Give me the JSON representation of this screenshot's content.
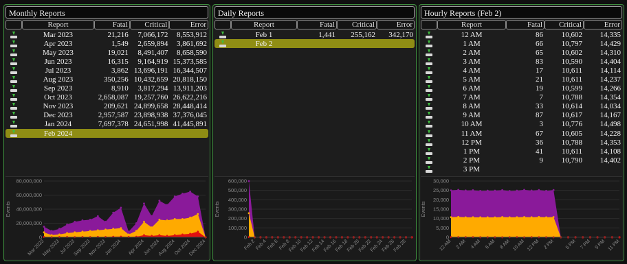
{
  "monthly": {
    "title": "Monthly Reports",
    "columns": {
      "report": "Report",
      "fatal": "Fatal",
      "critical": "Critical",
      "error": "Error"
    },
    "rows": [
      {
        "report": "Mar 2023",
        "fatal": "21,216",
        "critical": "7,066,172",
        "error": "8,553,912"
      },
      {
        "report": "Apr 2023",
        "fatal": "1,549",
        "critical": "2,659,894",
        "error": "3,861,692"
      },
      {
        "report": "May 2023",
        "fatal": "19,021",
        "critical": "8,491,407",
        "error": "8,658,590"
      },
      {
        "report": "Jun 2023",
        "fatal": "16,315",
        "critical": "9,164,919",
        "error": "15,373,585"
      },
      {
        "report": "Jul 2023",
        "fatal": "3,862",
        "critical": "13,696,191",
        "error": "16,344,507"
      },
      {
        "report": "Aug 2023",
        "fatal": "350,256",
        "critical": "10,432,659",
        "error": "20,818,150"
      },
      {
        "report": "Sep 2023",
        "fatal": "8,910",
        "critical": "3,817,294",
        "error": "13,911,203"
      },
      {
        "report": "Oct 2023",
        "fatal": "2,658,087",
        "critical": "19,257,760",
        "error": "26,622,216"
      },
      {
        "report": "Nov 2023",
        "fatal": "209,621",
        "critical": "24,899,658",
        "error": "28,448,414"
      },
      {
        "report": "Dec 2023",
        "fatal": "2,957,587",
        "critical": "23,898,938",
        "error": "37,376,045"
      },
      {
        "report": "Jan 2024",
        "fatal": "7,697,378",
        "critical": "24,651,998",
        "error": "41,445,891"
      },
      {
        "report": "Feb 2024",
        "fatal": "",
        "critical": "",
        "error": "",
        "selected": true
      }
    ]
  },
  "daily": {
    "title": "Daily Reports",
    "columns": {
      "report": "Report",
      "fatal": "Fatal",
      "critical": "Critical",
      "error": "Error"
    },
    "rows": [
      {
        "report": "Feb 1",
        "fatal": "1,441",
        "critical": "255,162",
        "error": "342,170"
      },
      {
        "report": "Feb 2",
        "fatal": "",
        "critical": "",
        "error": "",
        "selected": true
      }
    ]
  },
  "hourly": {
    "title": "Hourly Reports (Feb 2)",
    "columns": {
      "report": "Report",
      "fatal": "Fatal",
      "critical": "Critical",
      "error": "Error"
    },
    "rows": [
      {
        "report": "12 AM",
        "fatal": "86",
        "critical": "10,602",
        "error": "14,335"
      },
      {
        "report": "1 AM",
        "fatal": "66",
        "critical": "10,797",
        "error": "14,429"
      },
      {
        "report": "2 AM",
        "fatal": "65",
        "critical": "10,602",
        "error": "14,310"
      },
      {
        "report": "3 AM",
        "fatal": "83",
        "critical": "10,590",
        "error": "14,404"
      },
      {
        "report": "4 AM",
        "fatal": "17",
        "critical": "10,611",
        "error": "14,114"
      },
      {
        "report": "5 AM",
        "fatal": "21",
        "critical": "10,611",
        "error": "14,237"
      },
      {
        "report": "6 AM",
        "fatal": "19",
        "critical": "10,599",
        "error": "14,266"
      },
      {
        "report": "7 AM",
        "fatal": "7",
        "critical": "10,788",
        "error": "14,354"
      },
      {
        "report": "8 AM",
        "fatal": "33",
        "critical": "10,614",
        "error": "14,034"
      },
      {
        "report": "9 AM",
        "fatal": "87",
        "critical": "10,617",
        "error": "14,167"
      },
      {
        "report": "10 AM",
        "fatal": "3",
        "critical": "10,776",
        "error": "14,498"
      },
      {
        "report": "11 AM",
        "fatal": "67",
        "critical": "10,605",
        "error": "14,228"
      },
      {
        "report": "12 PM",
        "fatal": "36",
        "critical": "10,788",
        "error": "14,353"
      },
      {
        "report": "1 PM",
        "fatal": "41",
        "critical": "10,611",
        "error": "14,108"
      },
      {
        "report": "2 PM",
        "fatal": "9",
        "critical": "10,790",
        "error": "14,402"
      },
      {
        "report": "3 PM",
        "fatal": "",
        "critical": "",
        "error": ""
      }
    ]
  },
  "colors": {
    "fatal": "#e01010",
    "critical": "#ffaa00",
    "error": "#8a1a9a",
    "accent": "#8f8d14",
    "border": "#3f8f3f"
  },
  "chart_data": [
    {
      "type": "area",
      "ylabel": "Events",
      "ylim": [
        0,
        80000000
      ],
      "yticks": [
        "80,000,000",
        "60,000,000",
        "40,000,000",
        "20,000,000",
        "0"
      ],
      "ytick_values": [
        80000000,
        60000000,
        40000000,
        20000000,
        0
      ],
      "xticks": [
        "Mar 2023",
        "May 2023",
        "Jul 2023",
        "Sep 2023",
        "Nov 2023",
        "Jan 2024",
        "Apr 2024",
        "Jun 2024",
        "Aug 2024",
        "Oct 2024",
        "Dec 2024"
      ],
      "xtick_index": [
        0,
        2,
        4,
        6,
        8,
        10,
        13,
        15,
        17,
        19,
        21
      ],
      "n_points": 22,
      "series": [
        {
          "key": "error",
          "values": [
            15,
            9,
            12,
            18,
            22,
            24,
            25,
            30,
            22,
            35,
            42,
            8,
            20,
            48,
            30,
            52,
            46,
            58,
            62,
            65,
            58,
            0
          ]
        },
        {
          "key": "critical",
          "values": [
            7,
            3,
            4,
            6,
            7,
            8,
            9,
            10,
            11,
            12,
            13,
            4,
            9,
            22,
            14,
            25,
            24,
            26,
            26,
            28,
            33,
            0
          ]
        },
        {
          "key": "fatal",
          "values": [
            0.5,
            0.1,
            0.3,
            0.5,
            0.2,
            0.5,
            0.4,
            0.6,
            0.5,
            0.8,
            1,
            0.5,
            0.8,
            3,
            2,
            3,
            2,
            3,
            4,
            5,
            8,
            0
          ]
        }
      ],
      "series_scale": 1000000,
      "zero_tail": 22
    },
    {
      "type": "area",
      "ylabel": "Events",
      "ylim": [
        0,
        600000
      ],
      "yticks": [
        "600,000",
        "500,000",
        "400,000",
        "300,000",
        "200,000",
        "100,000",
        "0"
      ],
      "ytick_values": [
        600000,
        500000,
        400000,
        300000,
        200000,
        100000,
        0
      ],
      "xticks": [
        "Feb 2",
        "Feb 4",
        "Feb 6",
        "Feb 8",
        "Feb 10",
        "Feb 12",
        "Feb 14",
        "Feb 16",
        "Feb 18",
        "Feb 20",
        "Feb 22",
        "Feb 24",
        "Feb 26",
        "Feb 28"
      ],
      "xtick_index": [
        1,
        3,
        5,
        7,
        9,
        11,
        13,
        15,
        17,
        19,
        21,
        23,
        25,
        27
      ],
      "n_points": 29,
      "series": [
        {
          "key": "error",
          "values": [
            598773,
            0
          ]
        },
        {
          "key": "critical",
          "values": [
            256603,
            0
          ]
        },
        {
          "key": "fatal",
          "values": [
            1441,
            0
          ]
        }
      ],
      "series_scale": 1,
      "zero_tail": 29
    },
    {
      "type": "area",
      "ylabel": "Events",
      "ylim": [
        0,
        30000
      ],
      "yticks": [
        "30,000",
        "25,000",
        "20,000",
        "15,000",
        "10,000",
        "5,000",
        "0"
      ],
      "ytick_values": [
        30000,
        25000,
        20000,
        15000,
        10000,
        5000,
        0
      ],
      "xticks": [
        "12 AM",
        "2 AM",
        "4 AM",
        "6 AM",
        "8 AM",
        "10 AM",
        "12 PM",
        "2 PM",
        "5 PM",
        "7 PM",
        "9 PM",
        "11 PM"
      ],
      "xtick_index": [
        0,
        2,
        4,
        6,
        8,
        10,
        12,
        14,
        17,
        19,
        21,
        23
      ],
      "n_points": 24,
      "series": [
        {
          "key": "error",
          "values": [
            25023,
            25292,
            24977,
            25077,
            24742,
            24869,
            24884,
            25149,
            24681,
            24871,
            25277,
            24900,
            25177,
            24760,
            25201,
            0
          ]
        },
        {
          "key": "critical",
          "values": [
            10688,
            10863,
            10667,
            10673,
            10628,
            10632,
            10618,
            10795,
            10647,
            10704,
            10779,
            10672,
            10824,
            10652,
            10799,
            0
          ]
        },
        {
          "key": "fatal",
          "values": [
            86,
            66,
            65,
            83,
            17,
            21,
            19,
            7,
            33,
            87,
            3,
            67,
            36,
            41,
            9,
            0
          ]
        }
      ],
      "series_scale": 1,
      "zero_tail": 24
    }
  ]
}
